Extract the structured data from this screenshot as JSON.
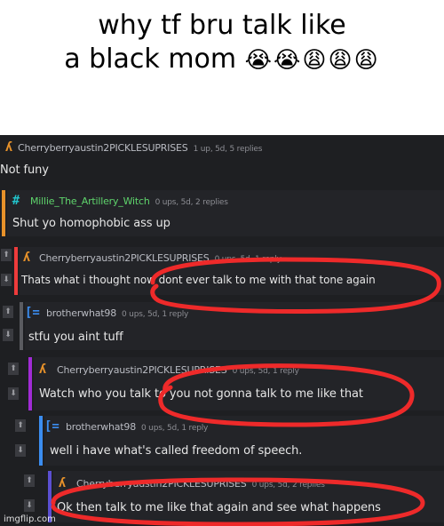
{
  "caption": {
    "line1": "why tf bru talk like",
    "line2": "a black mom",
    "emojis": "😭😭😩😩😩"
  },
  "comments": [
    {
      "user": "Cherryberryaustin2PICKLESUPRISES",
      "stats": "1 up, 5d, 5 replies",
      "text": "Not funy",
      "avatar_icon": "orange-pixel-avatar-icon"
    },
    {
      "user": "Millie_The_Artillery_Witch",
      "stats": "0 ups, 5d, 2 replies",
      "text": "Shut yo homophobic ass up",
      "avatar_icon": "teal-hash-avatar-icon"
    },
    {
      "user": "Cherryberryaustin2PICKLESUPRISES",
      "stats": "0 ups, 5d, 1 reply",
      "text": "Thats what i thought now dont ever talk to me with that tone again",
      "avatar_icon": "orange-pixel-avatar-icon"
    },
    {
      "user": "brotherwhat98",
      "stats": "0 ups, 5d, 1 reply",
      "text": "stfu you aint tuff",
      "avatar_icon": "blue-bracket-avatar-icon"
    },
    {
      "user": "Cherryberryaustin2PICKLESUPRISES",
      "stats": "0 ups, 5d, 1 reply",
      "text": "Watch who you talk to you not gonna talk to me like that",
      "avatar_icon": "orange-pixel-avatar-icon"
    },
    {
      "user": "brotherwhat98",
      "stats": "0 ups, 5d, 1 reply",
      "text": "well i have what's called freedom of speech.",
      "avatar_icon": "blue-bracket-avatar-icon"
    },
    {
      "user": "Cherryberryaustin2PICKLESUPRISES",
      "stats": "0 ups, 5d, 2 replies",
      "text": "Ok then talk to me like that again and see what happens",
      "avatar_icon": "orange-pixel-avatar-icon"
    }
  ],
  "colors": {
    "orange": "#e8922a",
    "teal": "#22c1c9",
    "purple": "#a12bd6",
    "blue": "#3b8df0",
    "indigo": "#5b4fd1",
    "gray": "#5a5b60",
    "annotation_red": "#ee2a2a"
  },
  "watermark": "imgflip.com"
}
